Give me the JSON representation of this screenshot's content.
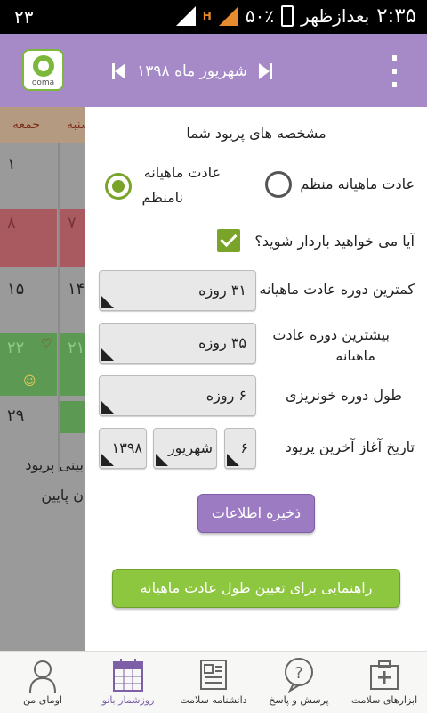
{
  "status_bar": {
    "notification_count": "۲۳",
    "time": "۲:۳۵",
    "period": "بعدازظهر",
    "battery": "۵۰٪"
  },
  "header": {
    "logo_text": "ooma",
    "month_title": "شهریور ماه ۱۳۹۸",
    "accent": "#a58ac7"
  },
  "calendar": {
    "weekday_friday": "جمعه",
    "weekday_partial": "شنبه",
    "cells": [
      "۱",
      "۸",
      "۷",
      "۱۵",
      "۱۴",
      "۲۲",
      "۲۱",
      "۲۹"
    ],
    "legend_1": "بینی پریود",
    "legend_2": "ن پایین"
  },
  "modal": {
    "title": "مشخصه های پریود شما",
    "radio_regular": "عادت ماهیانه منظم",
    "radio_irregular_line1": "عادت ماهیانه",
    "radio_irregular_line2": "نامنظم",
    "pregnancy_question": "آیا می خواهید باردار شوید؟",
    "min_cycle_label": "کمترین دوره عادت ماهیانه",
    "min_cycle_value": "۳۱ روزه",
    "max_cycle_label_line1": "بیشترین دوره عادت",
    "max_cycle_label_line2": "ماهیانه",
    "max_cycle_value": "۳۵ روزه",
    "bleeding_label": "طول دوره خونریزی",
    "bleeding_value": "۶ روزه",
    "last_period_label": "تاریخ آغاز آخرین پریود",
    "last_period_day": "۶",
    "last_period_month": "شهریور",
    "last_period_year": "۱۳۹۸",
    "save_button": "ذخیره اطلاعات",
    "guide_button": "راهنمایی برای تعیین طول عادت ماهیانه",
    "save_color": "#9c7bc2",
    "guide_color": "#8dc63f"
  },
  "bottom_nav": {
    "items": [
      {
        "label": "اومای من",
        "icon": "person-icon"
      },
      {
        "label": "روزشمار بانو",
        "icon": "calendar-icon"
      },
      {
        "label": "دانشنامه سلامت",
        "icon": "newspaper-icon"
      },
      {
        "label": "پرسش و پاسخ",
        "icon": "question-bubble-icon"
      },
      {
        "label": "ابزارهای سلامت",
        "icon": "medical-kit-icon"
      }
    ]
  }
}
